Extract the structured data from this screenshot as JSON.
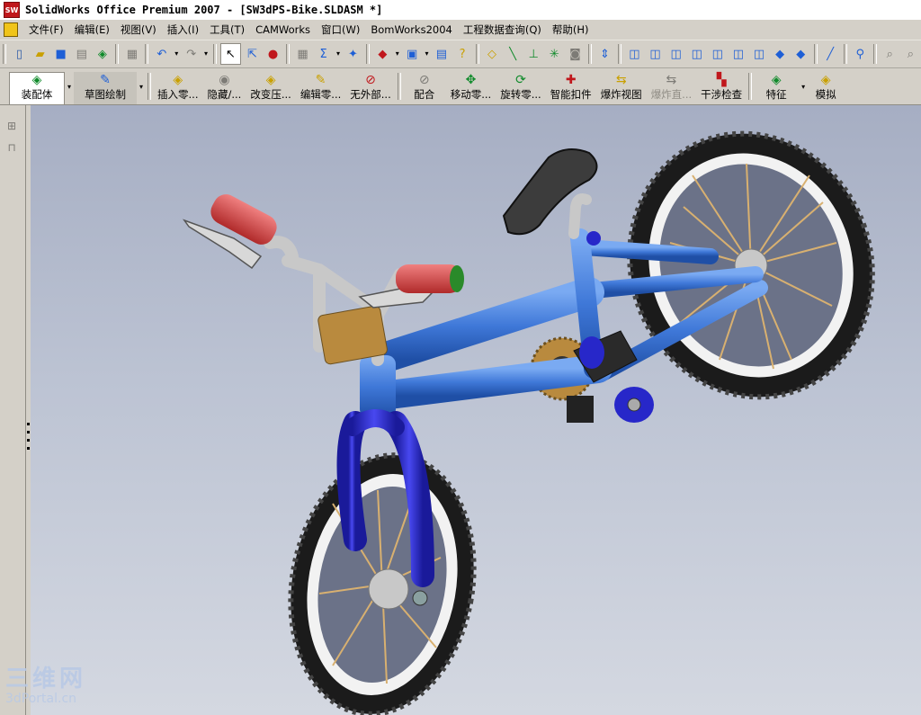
{
  "window": {
    "title": "SolidWorks Office Premium 2007 - [SW3dPS-Bike.SLDASM *]",
    "app_icon": "SW"
  },
  "menubar": {
    "items": [
      "文件(F)",
      "编辑(E)",
      "视图(V)",
      "插入(I)",
      "工具(T)",
      "CAMWorks",
      "窗口(W)",
      "BomWorks2004",
      "工程数据查询(Q)",
      "帮助(H)"
    ]
  },
  "toolbar": {
    "icons": [
      "new-icon",
      "open-icon",
      "save-icon",
      "print-preview-icon",
      "options-icon",
      "print-icon",
      "undo-icon",
      "redo-icon",
      "select-icon",
      "select-other-icon",
      "traffic-light-icon",
      "grid-icon",
      "sketch-icon",
      "rebuild-icon",
      "box-icon",
      "window-icon",
      "list-icon",
      "help-icon",
      "zoom-fit-icon",
      "line-icon",
      "axis-icon",
      "origin-icon",
      "camera-icon",
      "arrow-up-icon",
      "iso-view-icon",
      "front-view-icon",
      "back-view-icon",
      "left-view-icon",
      "right-view-icon",
      "top-view-icon",
      "bottom-view-icon",
      "normal-view-icon",
      "pin-icon",
      "link-icon",
      "zoom-icon",
      "zoom-window-icon"
    ]
  },
  "commandmanager": {
    "tabs": [
      {
        "label": "装配体",
        "icon": "assembly-icon"
      },
      {
        "label": "草图绘制",
        "icon": "sketch-icon"
      }
    ],
    "commands": [
      {
        "label": "插入零...",
        "icon": "insert-component-icon",
        "disabled": false
      },
      {
        "label": "隐藏/...",
        "icon": "hide-show-icon",
        "disabled": false
      },
      {
        "label": "改变压...",
        "icon": "change-suppression-icon",
        "disabled": false
      },
      {
        "label": "编辑零...",
        "icon": "edit-component-icon",
        "disabled": false
      },
      {
        "label": "无外部...",
        "icon": "no-external-icon",
        "disabled": false
      },
      {
        "label": "配合",
        "icon": "mate-icon",
        "disabled": false
      },
      {
        "label": "移动零...",
        "icon": "move-component-icon",
        "disabled": false
      },
      {
        "label": "旋转零...",
        "icon": "rotate-component-icon",
        "disabled": false
      },
      {
        "label": "智能扣件",
        "icon": "smart-fasteners-icon",
        "disabled": false
      },
      {
        "label": "爆炸视图",
        "icon": "exploded-view-icon",
        "disabled": false
      },
      {
        "label": "爆炸直...",
        "icon": "explode-line-icon",
        "disabled": true
      },
      {
        "label": "干涉检查",
        "icon": "interference-icon",
        "disabled": false
      },
      {
        "label": "特征",
        "icon": "features-icon",
        "disabled": false
      },
      {
        "label": "模拟",
        "icon": "simulation-icon",
        "disabled": false
      }
    ]
  },
  "watermark": {
    "big": "三维网",
    "small": "3dPortal.cn"
  },
  "colors": {
    "frame_blue": "#3f78d8",
    "fork_blue": "#2727c9",
    "grip_red": "#d84b4b",
    "tire": "#1b1b1b",
    "spoke": "#d8b070",
    "stem_gold": "#b98a3e",
    "viewport_top": "#a6aec3",
    "viewport_bottom": "#d4d8e1"
  }
}
